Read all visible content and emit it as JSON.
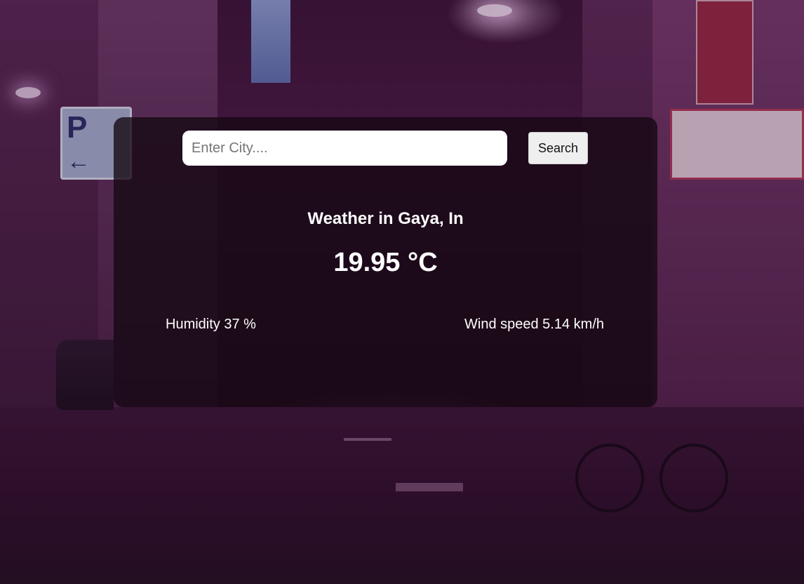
{
  "search": {
    "placeholder": "Enter City....",
    "value": "",
    "button_label": "Search"
  },
  "weather": {
    "title": "Weather in Gaya, In",
    "temperature": "19.95 °C",
    "humidity": "Humidity 37 %",
    "wind": "Wind speed 5.14 km/h"
  },
  "colors": {
    "card_background": "#140812",
    "text": "#ffffff",
    "background_tint": "#3b1638"
  }
}
